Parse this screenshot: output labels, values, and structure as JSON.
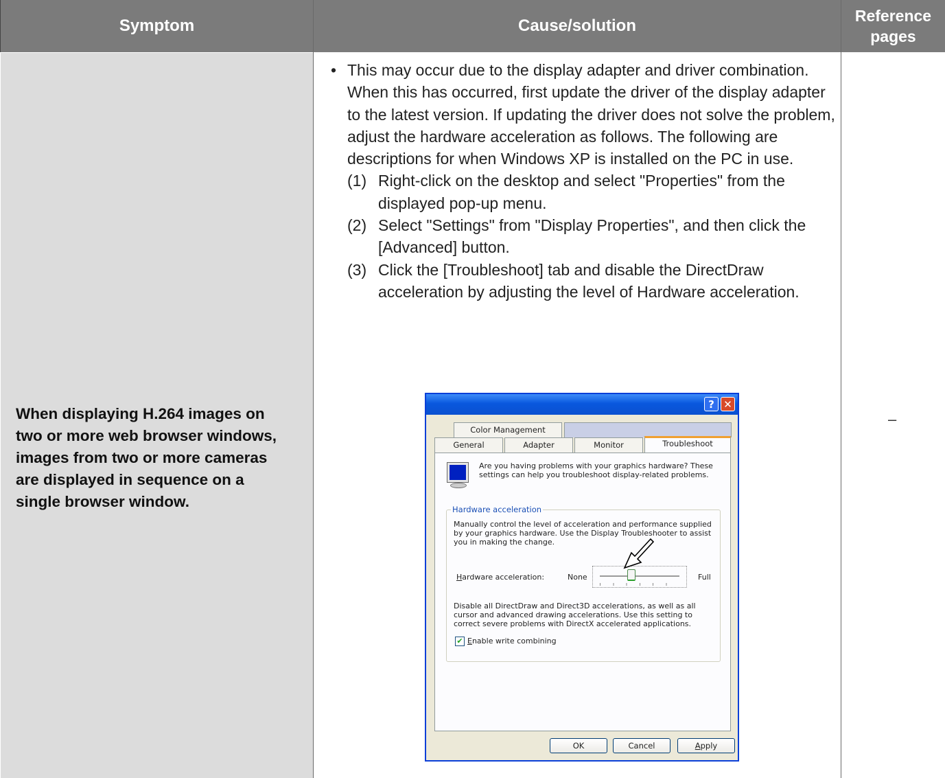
{
  "table": {
    "headers": {
      "symptom": "Symptom",
      "cause": "Cause/solution",
      "ref_line1": "Reference",
      "ref_line2": "pages"
    },
    "symptom": "When displaying H.264 images on two or more web browser windows, images from two or more cameras are displayed in sequence on a single browser window.",
    "cause": {
      "bullet": "This may occur due to the display adapter and driver combination. When this has occurred, first update the driver of the display adapter to the latest version. If updating the driver does not solve the problem, adjust the hardware acceleration as follows. The following are descriptions for when Windows XP is installed on the PC in use.",
      "steps": [
        {
          "num": "(1)",
          "text": "Right-click on the desktop and select \"Properties\" from the displayed pop-up menu."
        },
        {
          "num": "(2)",
          "text": "Select \"Settings\" from \"Display Properties\", and then click the [Advanced] button."
        },
        {
          "num": "(3)",
          "text": "Click the [Troubleshoot] tab and disable the DirectDraw acceleration by adjusting the level of Hardware acceleration."
        }
      ]
    },
    "reference": "–"
  },
  "dialog": {
    "help_button": "?",
    "close_button": "✕",
    "tabs": {
      "color_management": "Color Management",
      "general": "General",
      "adapter": "Adapter",
      "monitor": "Monitor",
      "troubleshoot": "Troubleshoot"
    },
    "intro": "Are you having problems with your graphics hardware? These settings can help you troubleshoot display-related problems.",
    "group_title": "Hardware acceleration",
    "group_desc": "Manually control the level of acceleration and performance supplied by your graphics hardware. Use the Display Troubleshooter to assist you in making the change.",
    "slider_label_first": "H",
    "slider_label_rest": "ardware acceleration:",
    "slider_min": "None",
    "slider_max": "Full",
    "slider_level_fraction": 0.4,
    "level_desc": "Disable all DirectDraw and Direct3D accelerations, as well as all cursor and advanced drawing accelerations. Use this setting to correct severe problems with DirectX accelerated applications.",
    "checkbox_first": "E",
    "checkbox_rest": "nable write combining",
    "checkbox_checked": true,
    "buttons": {
      "ok": "OK",
      "cancel": "Cancel",
      "apply_first": "A",
      "apply_rest": "pply"
    }
  }
}
